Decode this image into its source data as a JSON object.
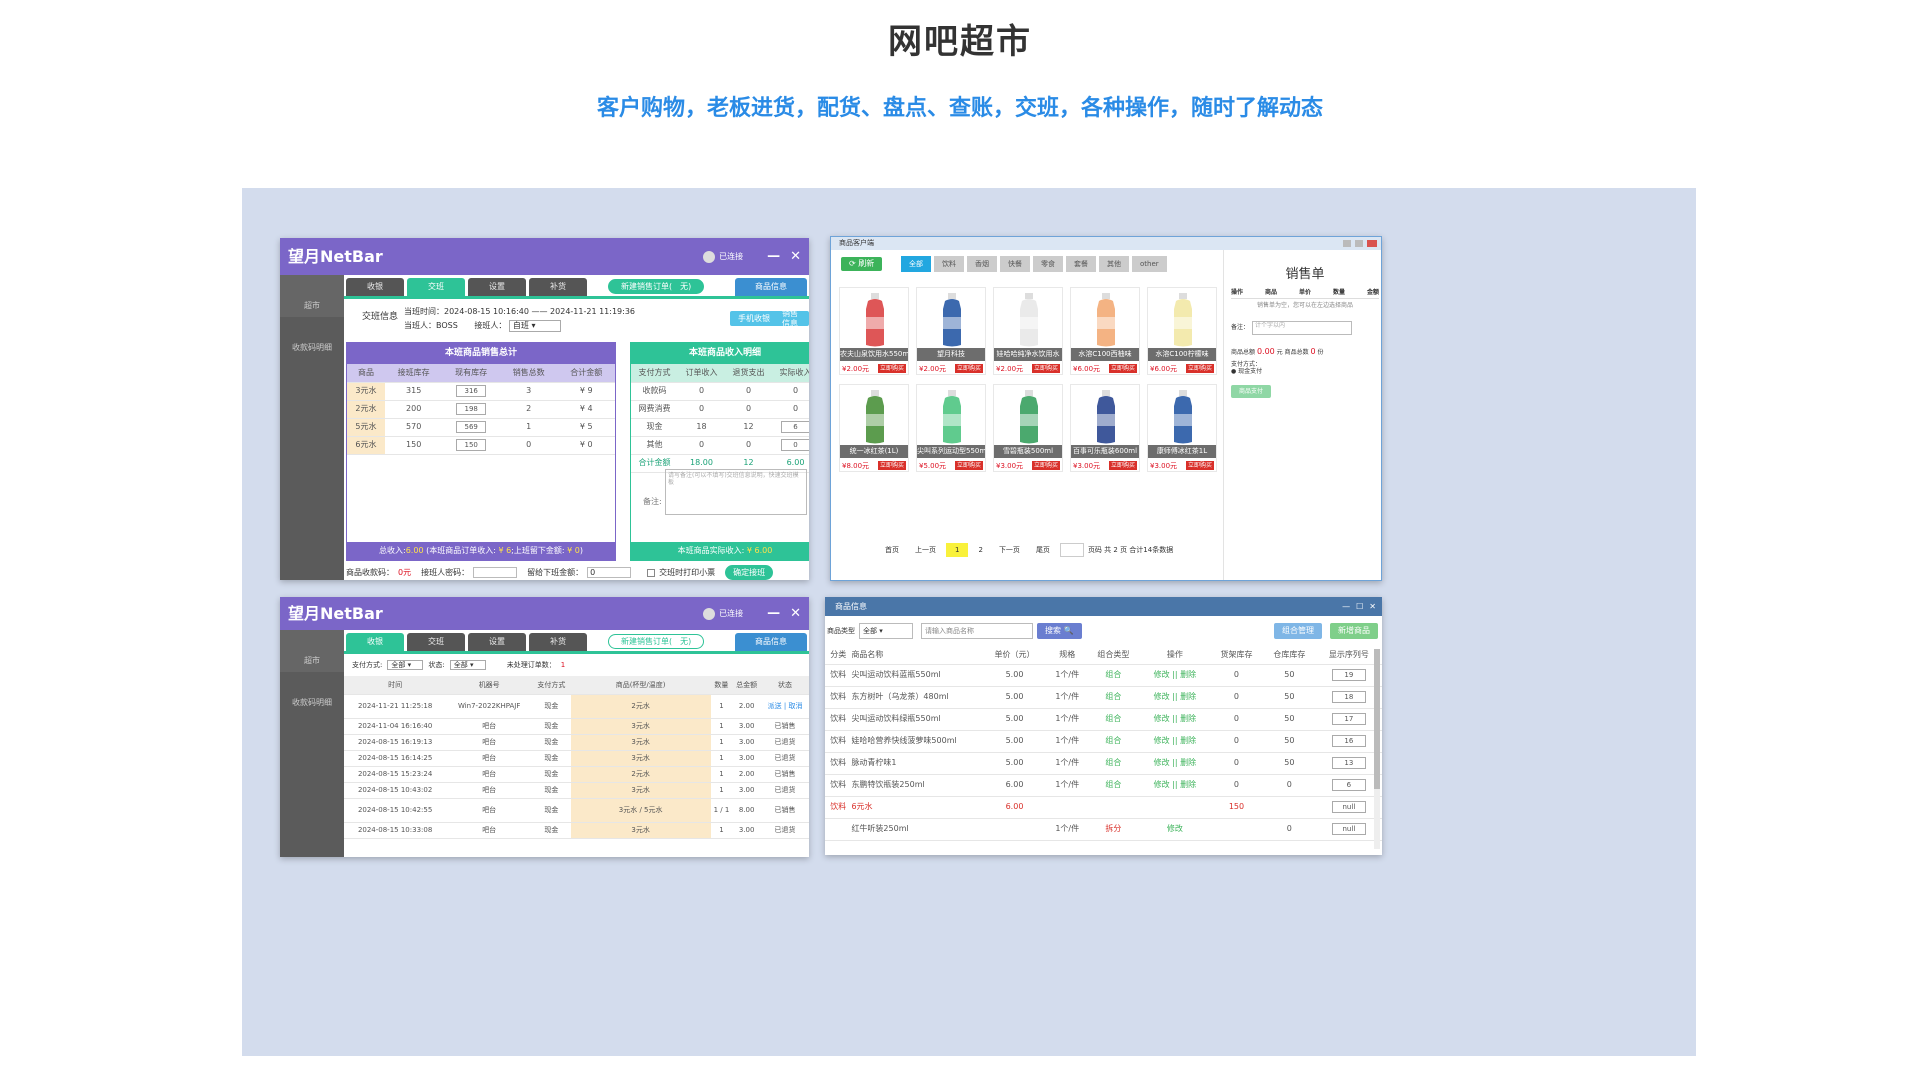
{
  "header": {
    "title": "网吧超市",
    "subtitle": "客户购物，老板进货，配货、盘点、查账，交班，各种操作，随时了解动态"
  },
  "common": {
    "app_title": "望月NetBar",
    "status": "已连接",
    "min": "—",
    "close": "✕",
    "tabs": [
      "收银",
      "交班",
      "设置",
      "补货"
    ],
    "new_order": "新建销售订单(　无)",
    "goods_info": "商品信息",
    "side": [
      "超市",
      "收款码明细"
    ]
  },
  "shot1": {
    "shift_label": "交班信息",
    "shift_time": "当班时间：2024-08-15 10:16:40 —— 2024-11-21 11:19:36",
    "cur_label": "当班人：",
    "cur_value": "BOSS",
    "next_label": "接班人：",
    "next_value": "自班",
    "btn_mobile": "手机收银",
    "btn_detail": "销售信息",
    "left_title": "本班商品销售总计",
    "left_headers": [
      "商品",
      "接班库存",
      "现有库存",
      "销售总数",
      "合计金额"
    ],
    "left_rows": [
      [
        "3元水",
        "315",
        "316",
        "3",
        "¥ 9"
      ],
      [
        "2元水",
        "200",
        "198",
        "2",
        "¥ 4"
      ],
      [
        "5元水",
        "570",
        "569",
        "1",
        "¥ 5"
      ],
      [
        "6元水",
        "150",
        "150",
        "0",
        "¥ 0"
      ]
    ],
    "left_footer_a": "总收入:",
    "left_footer_b": "6.00",
    "left_footer_c": " (本班商品订单收入: ",
    "left_footer_d": "¥ 6",
    "left_footer_e": ";上班留下金额: ",
    "left_footer_f": "¥ 0",
    "left_footer_g": ")",
    "right_title": "本班商品收入明细",
    "right_headers": [
      "支付方式",
      "订单收入",
      "退货支出",
      "实际收入"
    ],
    "right_rows": [
      [
        "收款码",
        "0",
        "0",
        "0"
      ],
      [
        "网费消费",
        "0",
        "0",
        "0"
      ],
      [
        "现金",
        "18",
        "12",
        "6"
      ],
      [
        "其他",
        "0",
        "0",
        "0"
      ]
    ],
    "right_total": [
      "合计金额",
      "18.00",
      "12",
      "6.00"
    ],
    "remark_label": "备注:",
    "remark_ph": "请写备注(可以不填写)交班信息说明，快速交班模板",
    "right_footer_a": "本班商品实际收入: ",
    "right_footer_b": "¥ 6.00",
    "bottom_qr": "商品收款码：",
    "bottom_qr_val": "0元",
    "bottom_pwd": "接班人密码：",
    "bottom_leave": "留给下班金额：",
    "bottom_leave_val": "0",
    "bottom_print": "交班时打印小票",
    "bottom_confirm": "确定接班"
  },
  "shot2": {
    "win_title": "商品客户端",
    "refresh": "⟳ 刷新",
    "cats": [
      "全部",
      "饮料",
      "香烟",
      "快餐",
      "零食",
      "套餐",
      "其他",
      "other"
    ],
    "products": [
      {
        "name": "农夫山泉饮用水550ml",
        "price": "¥2.00元",
        "color": "#d8383a"
      },
      {
        "name": "望月科技",
        "price": "¥2.00元",
        "color": "#1a4fa0"
      },
      {
        "name": "娃哈哈纯净水饮用水",
        "price": "¥2.00元",
        "color": "#e6e6e6"
      },
      {
        "name": "水溶C100西柚味",
        "price": "¥6.00元",
        "color": "#f2a66d"
      },
      {
        "name": "水溶C100柠檬味",
        "price": "¥6.00元",
        "color": "#f1e6a0"
      },
      {
        "name": "统一冰红茶(1L)",
        "price": "¥8.00元",
        "color": "#3f8b2f"
      },
      {
        "name": "尖叫系列运动型550ml",
        "price": "¥5.00元",
        "color": "#44c27a"
      },
      {
        "name": "雪碧瓶装500ml",
        "price": "¥3.00元",
        "color": "#2c9a55"
      },
      {
        "name": "百事可乐瓶装600ml",
        "price": "¥3.00元",
        "color": "#1d3b8a"
      },
      {
        "name": "康师傅冰红茶1L",
        "price": "¥3.00元",
        "color": "#1a4fa0"
      }
    ],
    "buy": "立即购买",
    "pager": [
      "首页",
      "上一页",
      "1",
      "2",
      "下一页",
      "尾页"
    ],
    "pager_info": "页码  共 2 页  合计14条数据",
    "order_title": "销售单",
    "order_headers": [
      "操作",
      "商品",
      "单价",
      "数量",
      "金额"
    ],
    "order_hint": "销售单为空，您可以在左边选择商品",
    "remark_label": "备注：",
    "remark_ph": "计个字以内",
    "total_a": "商品总额",
    "total_b": "0.00",
    "total_c": "元 商品总数",
    "total_d": "0",
    "total_e": "份",
    "pay_label": "支付方式：",
    "pay_cash": "● 现金支付",
    "pay_btn": "商品支付"
  },
  "shot3": {
    "pay_label": "支付方式:",
    "pay_val": "全部",
    "status_label": "状态:",
    "status_val": "全部",
    "unfinished": "未处理订单数：",
    "unfinished_val": "1",
    "headers": [
      "时间",
      "机器号",
      "支付方式",
      "商品(杯型/温度)",
      "数量",
      "总金额",
      "状态"
    ],
    "rows": [
      [
        "2024-11-21 11:25:18",
        "Win7-2022KHPAJF",
        "现金",
        "2元水",
        "1",
        "2.00",
        "派送 | 取消"
      ],
      [
        "2024-11-04 16:16:40",
        "吧台",
        "现金",
        "3元水",
        "1",
        "3.00",
        "已销售"
      ],
      [
        "2024-08-15 16:19:13",
        "吧台",
        "现金",
        "3元水",
        "1",
        "3.00",
        "已退货"
      ],
      [
        "2024-08-15 16:14:25",
        "吧台",
        "现金",
        "3元水",
        "1",
        "3.00",
        "已退货"
      ],
      [
        "2024-08-15 15:23:24",
        "吧台",
        "现金",
        "2元水",
        "1",
        "2.00",
        "已销售"
      ],
      [
        "2024-08-15 10:43:02",
        "吧台",
        "现金",
        "3元水",
        "1",
        "3.00",
        "已退货"
      ],
      [
        "2024-08-15 10:42:55",
        "吧台",
        "现金",
        "3元水 / 5元水",
        "1 / 1",
        "8.00",
        "已销售"
      ],
      [
        "2024-08-15 10:33:08",
        "吧台",
        "现金",
        "3元水",
        "1",
        "3.00",
        "已退货"
      ]
    ]
  },
  "shot4": {
    "win_title": "商品信息",
    "type_label": "商品类型",
    "type_val": "全部",
    "search_ph": "请输入商品名称",
    "search_btn": "搜索 🔍",
    "btn_combo": "组合管理",
    "btn_new": "新增商品",
    "headers": [
      "分类",
      "商品名称",
      "单价（元）",
      "规格",
      "组合类型",
      "操作",
      "货架库存",
      "仓库库存",
      "显示序列号"
    ],
    "rows": [
      [
        "饮料",
        "尖叫运动饮料蓝瓶550ml",
        "5.00",
        "1个/件",
        "组合",
        "修改 || 删除",
        "0",
        "50",
        "19"
      ],
      [
        "饮料",
        "东方树叶（乌龙茶）480ml",
        "5.00",
        "1个/件",
        "组合",
        "修改 || 删除",
        "0",
        "50",
        "18"
      ],
      [
        "饮料",
        "尖叫运动饮料绿瓶550ml",
        "5.00",
        "1个/件",
        "组合",
        "修改 || 删除",
        "0",
        "50",
        "17"
      ],
      [
        "饮料",
        "娃哈哈营养快线菠萝味500ml",
        "5.00",
        "1个/件",
        "组合",
        "修改 || 删除",
        "0",
        "50",
        "16"
      ],
      [
        "饮料",
        "脉动青柠味1",
        "5.00",
        "1个/件",
        "组合",
        "修改 || 删除",
        "0",
        "50",
        "13"
      ],
      [
        "饮料",
        "东鹏特饮瓶装250ml",
        "6.00",
        "1个/件",
        "组合",
        "修改 || 删除",
        "0",
        "0",
        "6"
      ],
      [
        "饮料",
        "6元水",
        "6.00",
        "",
        "",
        "",
        "150",
        "",
        "null"
      ],
      [
        "",
        "红牛听装250ml",
        "",
        "1个/件",
        "拆分",
        "修改",
        "",
        "0",
        "null"
      ]
    ]
  }
}
